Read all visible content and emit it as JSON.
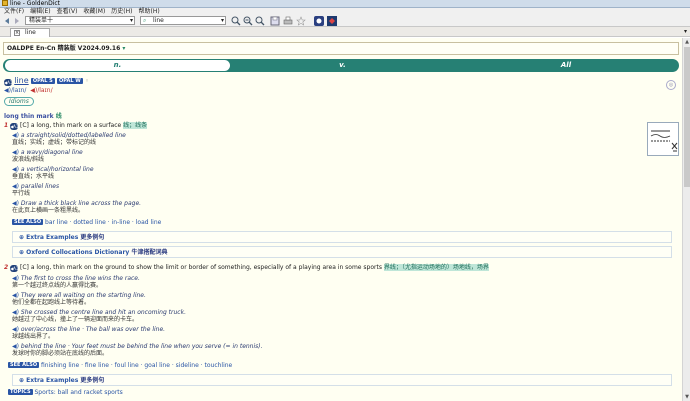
{
  "window": {
    "title": "line - GoldenDict"
  },
  "menu": [
    "文件(F)",
    "编辑(E)",
    "查看(V)",
    "收藏(M)",
    "历史(H)",
    "帮助(H)"
  ],
  "toolbar": {
    "group": "精装单十",
    "search_value": "line",
    "icon_names": [
      "back-icon",
      "forward-icon",
      "search-icon",
      "zoom-in-icon",
      "zoom-out-icon",
      "zoom-reset-icon",
      "save-icon",
      "print-icon",
      "favorite-icon",
      "scan-icon",
      "pronounce-icon"
    ]
  },
  "tab": {
    "label": "line"
  },
  "dictionary": {
    "name": "OALDPE En-Cn 精装版 V2024.09.16"
  },
  "pos_tabs": [
    "n.",
    "v.",
    "All"
  ],
  "headword": {
    "word": "line",
    "badges": [
      "OPAL S",
      "OPAL W"
    ],
    "uk": "/laɪn/",
    "us": "/laɪn/"
  },
  "idioms_label": "Idioms",
  "collocation_heading": {
    "en": "long thin mark",
    "zh": "线"
  },
  "senses": [
    {
      "num": "1",
      "grammar": "[C]",
      "def": "a long, thin mark on a surface",
      "zh": "线；线条",
      "examples": [
        {
          "en": "a straight/solid/dotted/labelled line",
          "zh": "直线；实线；虚线；带标记的线"
        },
        {
          "en": "a wavy/diagonal line",
          "zh": "波浪线/斜线"
        },
        {
          "en": "a vertical/horizontal line",
          "zh": "垂直线；水平线"
        },
        {
          "en": "parallel lines",
          "zh": "平行线"
        },
        {
          "en": "Draw a thick black line across the page.",
          "zh": "在此页上横画一条粗黑线。"
        }
      ],
      "see_also_label": "SEE ALSO",
      "see_also": "bar line · dotted line · in-line · load line",
      "extra_label": "Extra Examples",
      "extra_zh": "更多例句",
      "oxford_label": "Oxford Collocations Dictionary",
      "oxford_zh": "牛津搭配词典"
    },
    {
      "num": "2",
      "grammar": "[C]",
      "def": "a long, thin mark on the ground to show the limit or border of something, especially of a playing area in some sports",
      "zh": "界线；（尤指运动场地的）场地线，场界",
      "examples": [
        {
          "en": "The first to cross the line wins the race.",
          "zh": "第一个越过终点线的人赢得比赛。"
        },
        {
          "en": "They were all waiting on the starting line.",
          "zh": "他们全都在起跑线上等待着。"
        },
        {
          "en": "She crossed the centre line and hit an oncoming truck.",
          "zh": "她越过了中心线，撞上了一辆迎面而来的卡车。"
        },
        {
          "en": "over/across the line · The ball was over the line.",
          "zh": "球越线出界了。"
        },
        {
          "en": "behind the line · Your feet must be behind the line when you serve (= in tennis).",
          "zh": "发球时你的脚必须站在底线的后面。"
        }
      ],
      "see_also_label": "SEE ALSO",
      "see_also": "finishing line · fine line · foul line · goal line · sideline · touchline",
      "extra_label": "Extra Examples",
      "extra_zh": "更多例句",
      "topic_label": "TOPICS",
      "topic": "Sports: ball and racket sports"
    }
  ],
  "colors": {
    "accent": "#268074",
    "bg": "#fffff2"
  }
}
